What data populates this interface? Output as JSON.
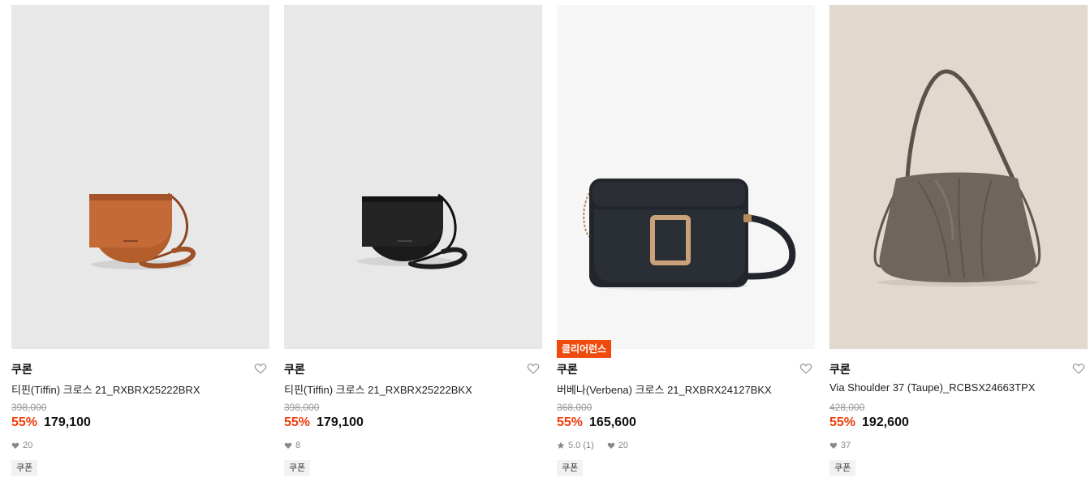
{
  "products": [
    {
      "brand": "쿠론",
      "name": "티핀(Tiffin) 크로스 21_RXBRX25222BRX",
      "original_price": "398,000",
      "discount": "55%",
      "sale_price": "179,100",
      "likes": "20",
      "tag": "쿠폰",
      "image_bg": "#e8e8e8",
      "bag_color": "#b45e2c",
      "bag_type": "saddle"
    },
    {
      "brand": "쿠론",
      "name": "티핀(Tiffin) 크로스 21_RXBRX25222BKX",
      "original_price": "398,000",
      "discount": "55%",
      "sale_price": "179,100",
      "likes": "8",
      "tag": "쿠폰",
      "image_bg": "#e8e8e8",
      "bag_color": "#1c1c1c",
      "bag_type": "saddle"
    },
    {
      "badge": "클리어런스",
      "brand": "쿠론",
      "name": "버베나(Verbena) 크로스 21_RXBRX24127BKX",
      "original_price": "368,000",
      "discount": "55%",
      "sale_price": "165,600",
      "rating": "5.0 (1)",
      "likes": "20",
      "tag": "쿠폰",
      "image_bg": "#f6f6f6",
      "bag_color": "#23262c",
      "bag_type": "box"
    },
    {
      "brand": "쿠론",
      "name": "Via Shoulder 37 (Taupe)_RCBSX24663TPX",
      "original_price": "428,000",
      "discount": "55%",
      "sale_price": "192,600",
      "likes": "37",
      "tag": "쿠폰",
      "image_bg": "#e2d8ce",
      "bag_color": "#6e665d",
      "bag_type": "hobo"
    }
  ],
  "colors": {
    "discount": "#ee3d0d",
    "badge": "#ee4b0c"
  },
  "icons": {
    "heart": "heart-outline-icon",
    "like": "heart-filled-icon",
    "rating": "star-icon"
  }
}
